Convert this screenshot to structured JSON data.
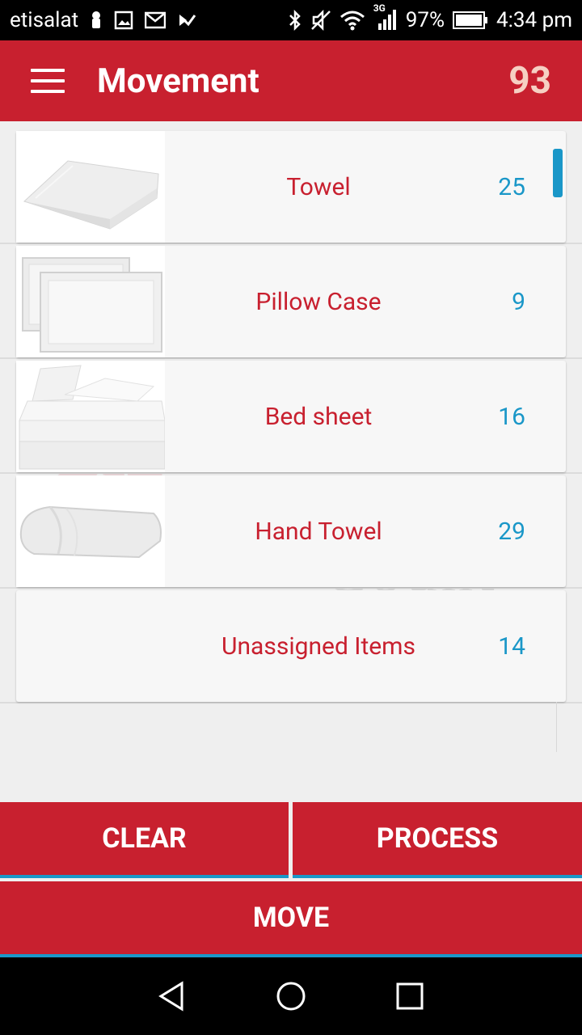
{
  "status_bar": {
    "carrier": "etisalat",
    "network": "3G",
    "battery": "97%",
    "time": "4:34 pm"
  },
  "app_bar": {
    "title": "Movement",
    "total_count": "93"
  },
  "items": [
    {
      "name": "Towel",
      "count": "25",
      "image": "towel-image"
    },
    {
      "name": "Pillow Case",
      "count": "9",
      "image": "pillow-case-image"
    },
    {
      "name": "Bed sheet",
      "count": "16",
      "image": "bed-sheet-image"
    },
    {
      "name": "Hand Towel",
      "count": "29",
      "image": "hand-towel-image"
    },
    {
      "name": "Unassigned Items",
      "count": "14",
      "image": ""
    }
  ],
  "watermark": {
    "brand": "gif",
    "line1": "Linen",
    "line2": "Count"
  },
  "buttons": {
    "clear": "CLEAR",
    "process": "PROCESS",
    "move": "MOVE"
  },
  "colors": {
    "primary": "#c8202f",
    "accent": "#1a97c8",
    "count_highlight": "#f6d0c3"
  }
}
